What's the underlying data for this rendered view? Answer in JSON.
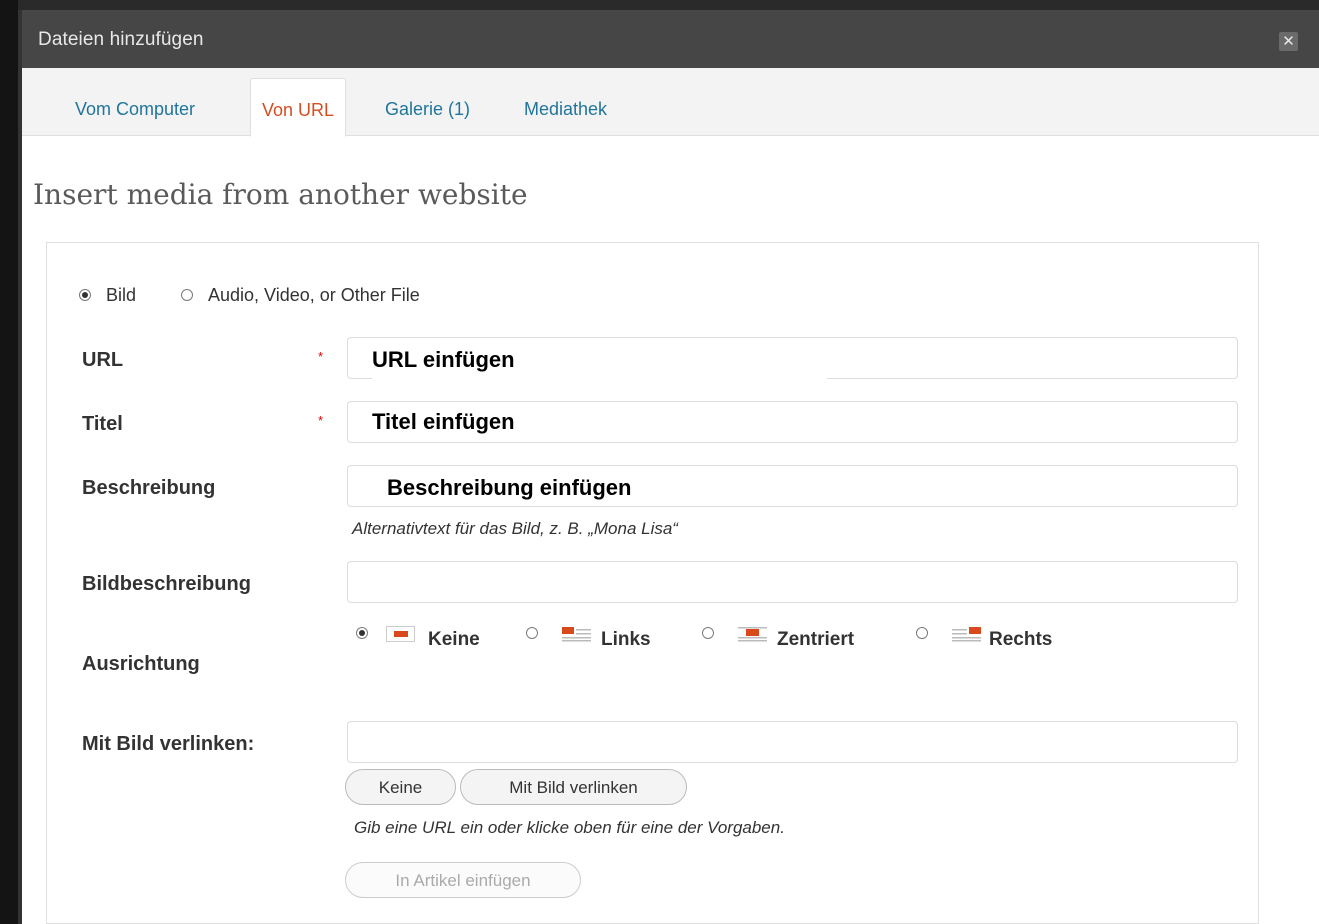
{
  "window": {
    "title": "Dateien hinzufügen",
    "close_glyph": "✕"
  },
  "tabs": [
    {
      "label": "Vom Computer",
      "active": false
    },
    {
      "label": "Von URL",
      "active": true
    },
    {
      "label": "Galerie (1)",
      "active": false
    },
    {
      "label": "Mediathek",
      "active": false
    }
  ],
  "heading": "Insert media from another website",
  "media_type": {
    "options": [
      {
        "label": "Bild",
        "checked": true
      },
      {
        "label": "Audio, Video, or Other File",
        "checked": false
      }
    ]
  },
  "form": {
    "required_mark": "*",
    "url": {
      "label": "URL",
      "overlay": "URL einfügen",
      "value": ""
    },
    "title": {
      "label": "Titel",
      "overlay": "Titel einfügen",
      "value": ""
    },
    "description": {
      "label": "Beschreibung",
      "overlay": "Beschreibung einfügen",
      "help": "Alternativtext für das Bild, z. B. „Mona Lisa“",
      "value": ""
    },
    "caption": {
      "label": "Bildbeschreibung",
      "value": ""
    },
    "alignment": {
      "label": "Ausrichtung",
      "options": [
        {
          "label": "Keine",
          "checked": true,
          "icon": "align-none-icon"
        },
        {
          "label": "Links",
          "checked": false,
          "icon": "align-left-icon"
        },
        {
          "label": "Zentriert",
          "checked": false,
          "icon": "align-center-icon"
        },
        {
          "label": "Rechts",
          "checked": false,
          "icon": "align-right-icon"
        }
      ]
    },
    "link": {
      "label": "Mit Bild verlinken:",
      "value": "",
      "none_button": "Keine",
      "link_button": "Mit Bild verlinken",
      "help": "Gib eine URL ein oder klicke oben für eine der Vorgaben."
    },
    "insert_button": "In Artikel einfügen"
  },
  "colors": {
    "accent": "#d54e21",
    "link": "#21759b",
    "titlebar": "#464646",
    "icon_red": "#d84a1b"
  }
}
